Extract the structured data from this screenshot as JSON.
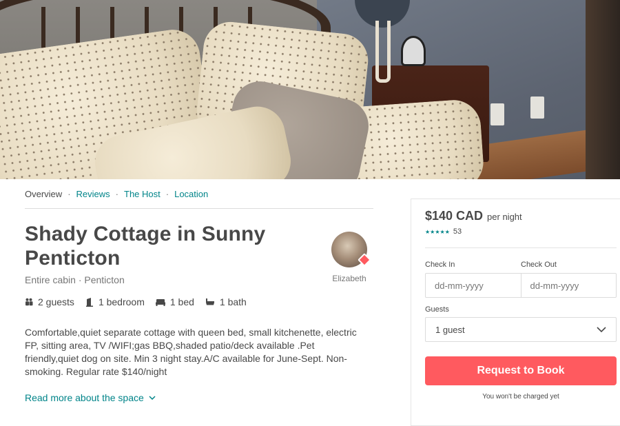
{
  "hero": {
    "image": "bedroom-with-pillows-photo"
  },
  "tabs": [
    {
      "label": "Overview",
      "active": true
    },
    {
      "label": "Reviews",
      "active": false
    },
    {
      "label": "The Host",
      "active": false
    },
    {
      "label": "Location",
      "active": false
    }
  ],
  "tab_separator": "·",
  "listing": {
    "title": "Shady Cottage in Sunny Penticton",
    "subtitle": "Entire cabin · Penticton",
    "amenities": [
      {
        "icon": "guests-icon",
        "label": "2 guests"
      },
      {
        "icon": "bedroom-icon",
        "label": "1 bedroom"
      },
      {
        "icon": "bed-icon",
        "label": "1 bed"
      },
      {
        "icon": "bath-icon",
        "label": "1 bath"
      }
    ],
    "description": "Comfortable,quiet separate cottage with queen bed, small kitchenette, electric FP, sitting area, TV /WIFI;gas BBQ,shaded patio/deck available .Pet friendly,quiet dog on site. Min 3 night stay.A/C available for June-Sept. Non-smoking. Regular rate $140/night",
    "read_more": "Read more about the space"
  },
  "host": {
    "name": "Elizabeth"
  },
  "booking": {
    "price": "$140 CAD",
    "per": "per night",
    "stars": "★★★★★",
    "review_count": "53",
    "check_in_label": "Check In",
    "check_out_label": "Check Out",
    "check_in_placeholder": "dd-mm-yyyy",
    "check_out_placeholder": "dd-mm-yyyy",
    "guests_label": "Guests",
    "guests_value": "1 guest",
    "button": "Request to Book",
    "note": "You won't be charged yet"
  },
  "colors": {
    "accent": "#008489",
    "brand": "#ff5a5f",
    "text": "#484848"
  }
}
